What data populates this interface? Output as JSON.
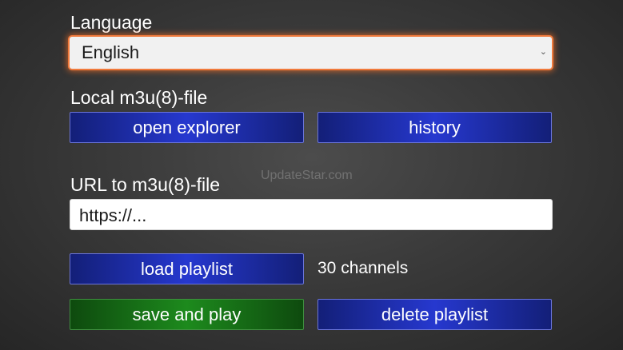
{
  "language": {
    "label": "Language",
    "selected": "English",
    "chevron": "⌄"
  },
  "local_file": {
    "label": "Local m3u(8)-file",
    "open_explorer_label": "open explorer",
    "history_label": "history"
  },
  "watermark": "UpdateStar.com",
  "url": {
    "label": "URL to m3u(8)-file",
    "value": "https://..."
  },
  "playlist": {
    "load_label": "load playlist",
    "channel_count": "30 channels",
    "save_play_label": "save and play",
    "delete_label": "delete playlist"
  },
  "colors": {
    "button_blue": "#2638cf",
    "button_green": "#1d8a1d",
    "focus_orange": "#f07a3c"
  }
}
